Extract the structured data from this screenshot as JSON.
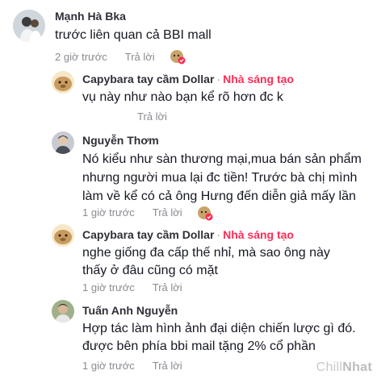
{
  "comments": [
    {
      "author": "Mạnh Hà Bka",
      "badge": "",
      "text": [
        "trước liên quan cả BBI mall"
      ],
      "time": "2 giờ trước",
      "reply": "Trả lời",
      "liked_by_creator": true
    },
    {
      "author": "Capybara tay cầm Dollar",
      "badge": "Nhà sáng tạo",
      "text": [
        "vụ này như nào bạn kể rõ hơn đc k"
      ],
      "time": "",
      "reply": "Trả lời",
      "liked_by_creator": false
    },
    {
      "author": "Nguyễn Thơm",
      "badge": "",
      "text": [
        "Nó kiểu như sàn thương mại,mua bán sản phẩm",
        "nhưng người mua lại đc tiền! Trước bà chị mình",
        "làm về kể có cả ông Hưng đến diễn giả mấy lần"
      ],
      "time": "1 giờ trước",
      "reply": "Trả lời",
      "liked_by_creator": true
    },
    {
      "author": "Capybara tay cầm Dollar",
      "badge": "Nhà sáng tạo",
      "text": [
        "nghe giống đa cấp thế nhỉ, mà sao ông này",
        "thấy ở đâu cũng có mặt"
      ],
      "time": "1 giờ trước",
      "reply": "Trả lời",
      "liked_by_creator": false
    },
    {
      "author": "Tuấn Anh Nguyễn",
      "badge": "",
      "text": [
        "Hợp tác làm hình ảnh đại diện chiến lược gì đó.",
        "được bên phía bbi mail tặng 2% cổ phần"
      ],
      "time": "1 giờ trước",
      "reply": "Trả lời",
      "liked_by_creator": false
    }
  ],
  "watermark": {
    "part1": "Chill",
    "part2": "Nhat"
  },
  "colors": {
    "creator_badge": "#fe2c55",
    "meta": "#8a8b91",
    "text": "#161823"
  }
}
